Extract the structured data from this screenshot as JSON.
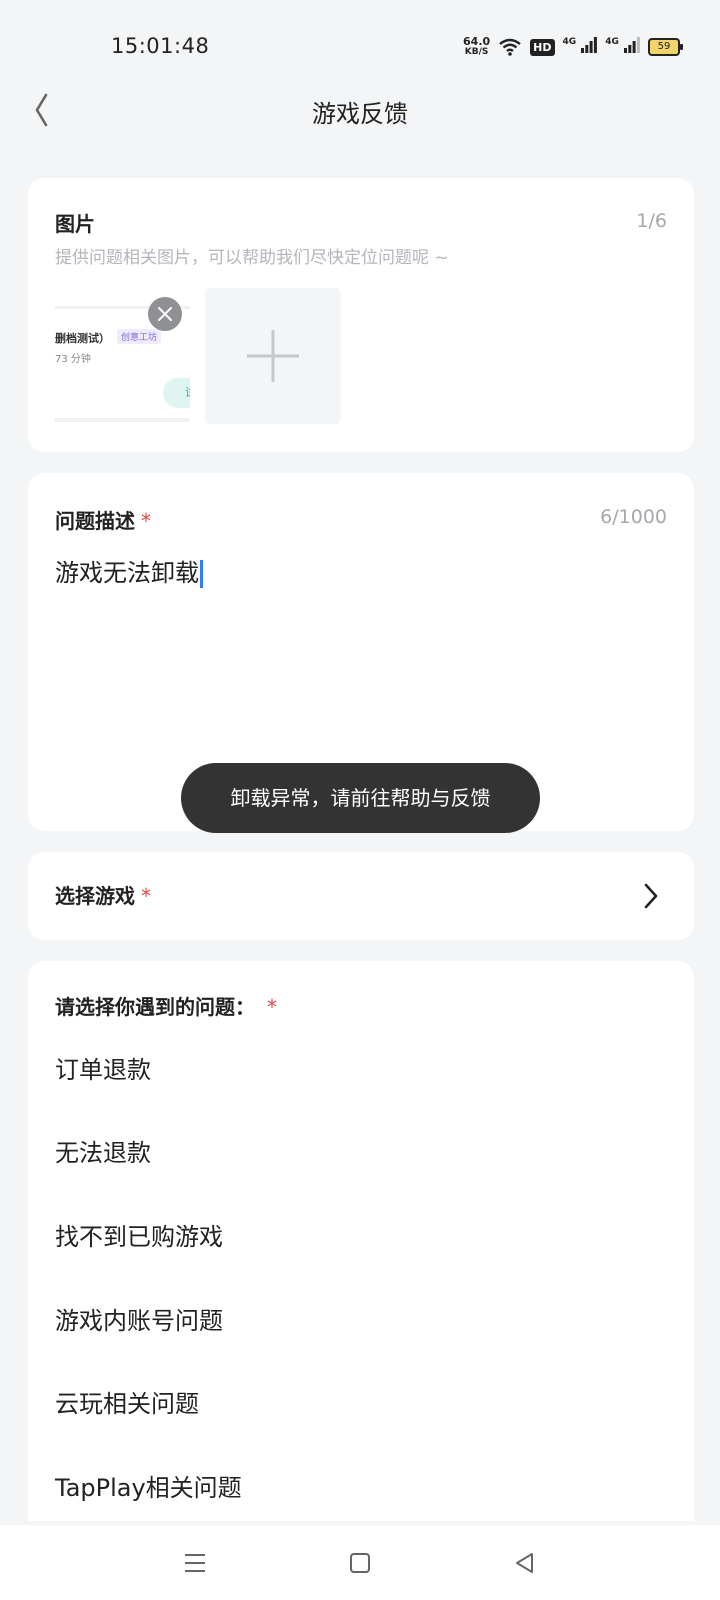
{
  "status_bar": {
    "time": "15:01:48",
    "net_speed_value": "64.0",
    "net_speed_unit": "KB/S",
    "hd_label": "HD",
    "signal1_label": "4G",
    "signal2_label": "4G",
    "battery_level": "59"
  },
  "header": {
    "title": "游戏反馈"
  },
  "images_section": {
    "title": "图片",
    "counter": "1/6",
    "hint": "提供问题相关图片，可以帮助我们尽快定位问题呢 ~",
    "thumbnail": {
      "title": "删档测试）",
      "tag": "创意工坊",
      "subtitle": "73 分钟",
      "pill_text": "试"
    }
  },
  "description_section": {
    "title": "问题描述",
    "required_mark": "*",
    "counter": "6/1000",
    "value": "游戏无法卸载"
  },
  "toast": {
    "message": "卸载异常，请前往帮助与反馈"
  },
  "game_select": {
    "label": "选择游戏",
    "required_mark": "*"
  },
  "issues_section": {
    "title": "请选择你遇到的问题：",
    "required_mark": "*",
    "options": [
      "订单退款",
      "无法退款",
      "找不到已购游戏",
      "游戏内账号问题",
      "云玩相关问题",
      "TapPlay相关问题"
    ]
  },
  "colors": {
    "background": "#f4f5f7",
    "required": "#e54848",
    "caret": "#2b7cff",
    "toast_bg": "#333333"
  }
}
